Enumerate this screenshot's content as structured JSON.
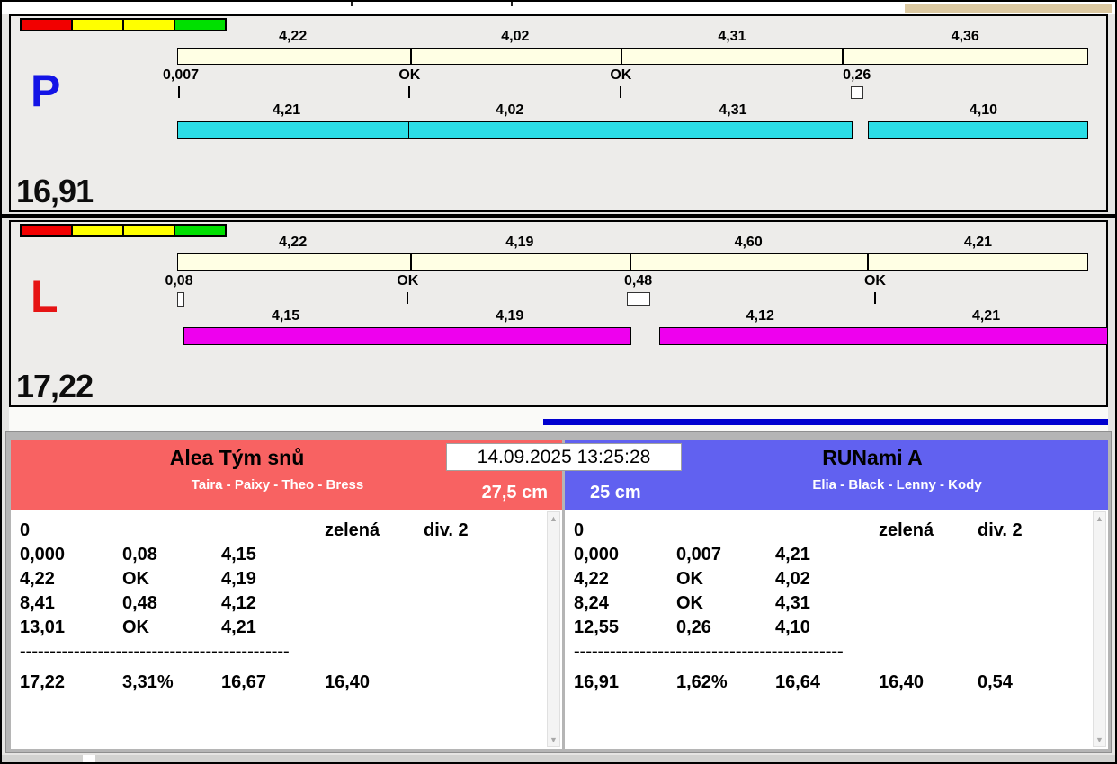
{
  "datetime": "14.09.2025 13:25:28",
  "status_lights": [
    "#f20000",
    "#ffff00",
    "#ffff00",
    "#00e000"
  ],
  "icons": {
    "scroll_up": "▲",
    "scroll_down": "▼"
  },
  "ui": {
    "blue_line_color": "#0000cf",
    "top_right_block_color": "#dcc9a1"
  },
  "lanes": [
    {
      "letter": "P",
      "letter_color": "#1414e6",
      "total": "16,91",
      "ideal_bar_color": "#ffffe4",
      "run_bar_color": "#2bdde6",
      "ideal_splits": [
        "4,22",
        "4,02",
        "4,31",
        "4,36"
      ],
      "exchange_labels": [
        "0,007",
        "OK",
        "OK",
        "0,26"
      ],
      "run_splits": [
        "4,21",
        "4,02",
        "4,31",
        "4,10"
      ]
    },
    {
      "letter": "L",
      "letter_color": "#e61414",
      "total": "17,22",
      "ideal_bar_color": "#ffffe4",
      "run_bar_color": "#ee00ee",
      "ideal_splits": [
        "4,22",
        "4,19",
        "4,60",
        "4,21"
      ],
      "exchange_labels": [
        "0,08",
        "OK",
        "0,48",
        "OK"
      ],
      "run_splits": [
        "4,15",
        "4,19",
        "4,12",
        "4,21"
      ]
    }
  ],
  "teams": [
    {
      "name": "Alea Tým snů",
      "members": "Taira - Paixy - Theo - Bress",
      "jump_height": "27,5 cm",
      "header_color": "#f86262",
      "rows": [
        [
          "0",
          "",
          "",
          "zelená",
          "div. 2"
        ],
        [
          "0,000",
          "0,08",
          "4,15",
          "",
          ""
        ],
        [
          "4,22",
          "OK",
          "4,19",
          "",
          ""
        ],
        [
          "8,41",
          "0,48",
          "4,12",
          "",
          ""
        ],
        [
          "13,01",
          "OK",
          "4,21",
          "",
          ""
        ]
      ],
      "separator": "---------------------------------------------",
      "summary": [
        "17,22",
        "3,31%",
        "16,67",
        "16,40",
        ""
      ]
    },
    {
      "name": "RUNami A",
      "members": "Elia - Black - Lenny - Kody",
      "jump_height": "25 cm",
      "header_color": "#6161f0",
      "rows": [
        [
          "0",
          "",
          "",
          "zelená",
          "div. 2"
        ],
        [
          "0,000",
          "0,007",
          "4,21",
          "",
          ""
        ],
        [
          "4,22",
          "OK",
          "4,02",
          "",
          ""
        ],
        [
          "8,24",
          "OK",
          "4,31",
          "",
          ""
        ],
        [
          "12,55",
          "0,26",
          "4,10",
          "",
          ""
        ]
      ],
      "separator": "---------------------------------------------",
      "summary": [
        "16,91",
        "1,62%",
        "16,64",
        "16,40",
        "0,54"
      ]
    }
  ]
}
